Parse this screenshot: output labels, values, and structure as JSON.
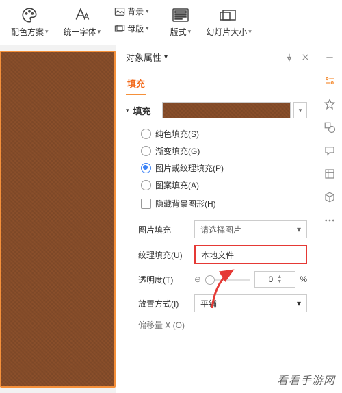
{
  "toolbar": {
    "color_scheme": {
      "label": "配色方案"
    },
    "font_unify": {
      "label": "统一字体"
    },
    "background": {
      "label": "背景"
    },
    "master": {
      "label": "母版"
    },
    "layout": {
      "label": "版式"
    },
    "slide_size": {
      "label": "幻灯片大小"
    }
  },
  "panel": {
    "title": "对象属性",
    "tab_fill": "填充",
    "section_fill": "填充",
    "fill_options": {
      "solid": "纯色填充(S)",
      "gradient": "渐变填充(G)",
      "picture": "图片或纹理填充(P)",
      "pattern": "图案填充(A)",
      "hide_bg": "隐藏背景图形(H)"
    },
    "picture_fill_label": "图片填充",
    "picture_fill_value": "请选择图片",
    "texture_fill_label": "纹理填充(U)",
    "texture_fill_value": "本地文件",
    "opacity_label": "透明度(T)",
    "opacity_value": "0",
    "opacity_unit": "%",
    "tile_label": "放置方式(I)",
    "tile_value": "平铺",
    "offset_label": "偏移量 X (O)"
  },
  "watermark": "看看手游网"
}
